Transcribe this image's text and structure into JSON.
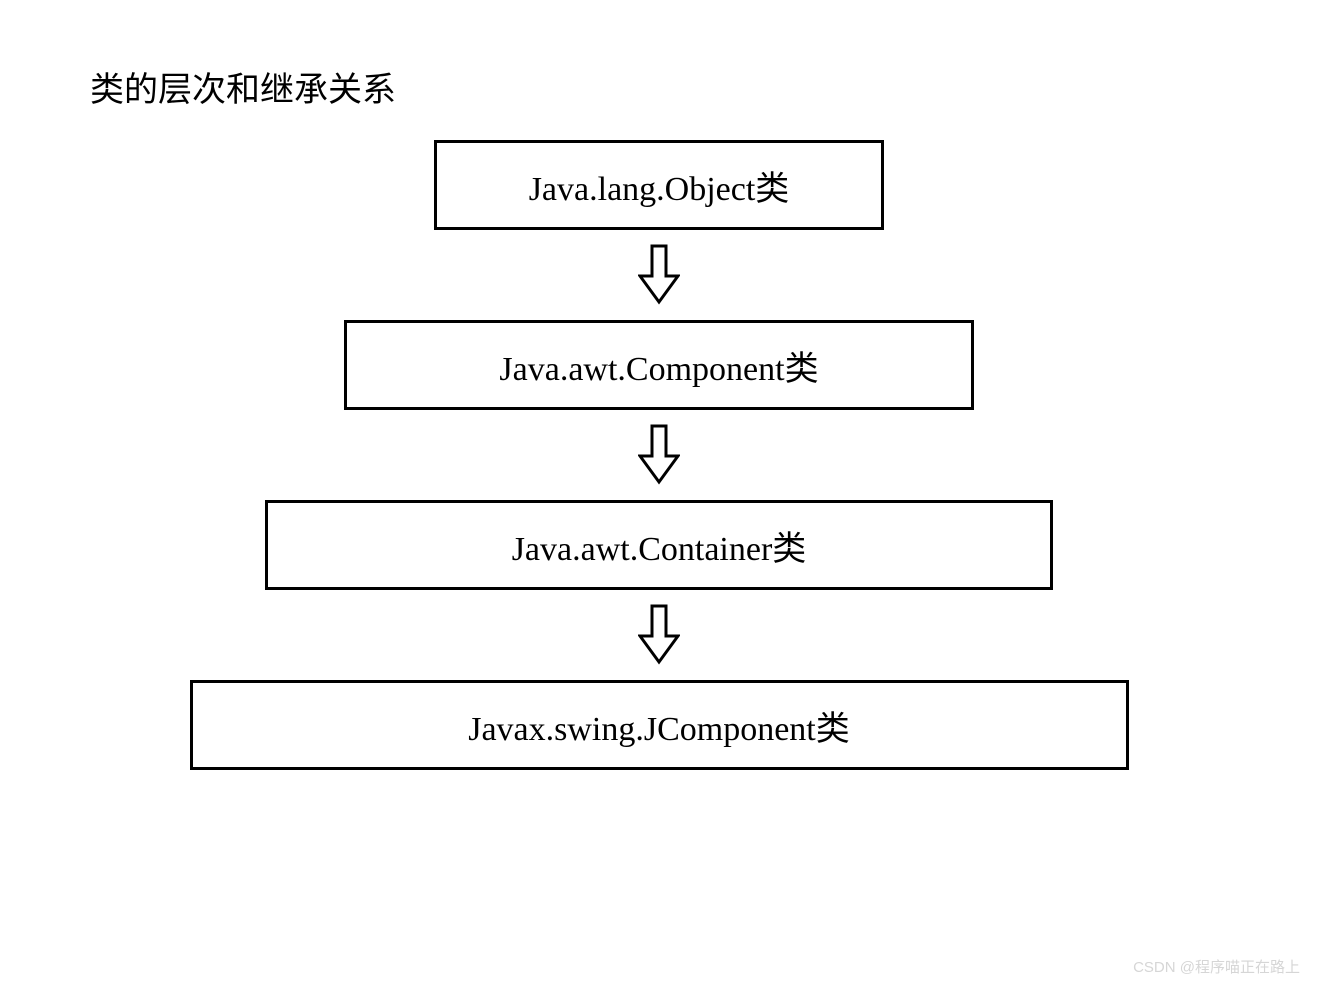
{
  "title": "类的层次和继承关系",
  "boxes": {
    "b1": "Java.lang.Object类",
    "b2": "Java.awt.Component类",
    "b3": "Java.awt.Container类",
    "b4": "Javax.swing.JComponent类"
  },
  "watermark": "CSDN @程序喵正在路上"
}
